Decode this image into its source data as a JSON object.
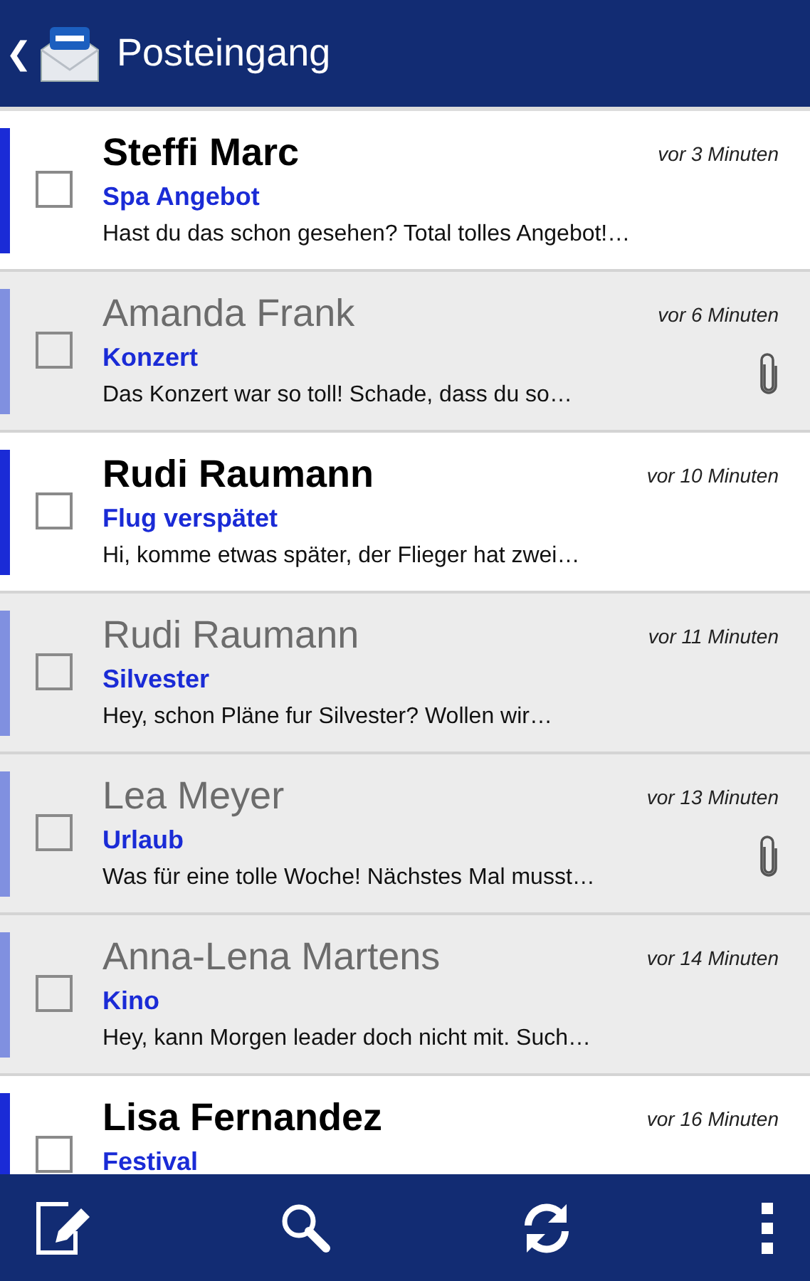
{
  "app_bar": {
    "back": "❮",
    "title": "Posteingang"
  },
  "messages": [
    {
      "sender": "Steffi Marc",
      "subject": "Spa Angebot",
      "preview": "Hast du das schon gesehen? Total tolles Angebot!…",
      "time": "vor 3 Minuten",
      "unread": true,
      "attachment": false,
      "checked": false
    },
    {
      "sender": "Amanda Frank",
      "subject": "Konzert",
      "preview": "Das Konzert war so toll! Schade, dass du so…",
      "time": "vor 6 Minuten",
      "unread": false,
      "attachment": true,
      "checked": false
    },
    {
      "sender": "Rudi Raumann",
      "subject": "Flug verspätet",
      "preview": "Hi, komme etwas später, der Flieger hat zwei…",
      "time": "vor 10 Minuten",
      "unread": true,
      "attachment": false,
      "checked": false
    },
    {
      "sender": "Rudi Raumann",
      "subject": "Silvester",
      "preview": "Hey, schon Pläne fur Silvester? Wollen wir…",
      "time": "vor 11 Minuten",
      "unread": false,
      "attachment": false,
      "checked": false
    },
    {
      "sender": "Lea Meyer",
      "subject": "Urlaub",
      "preview": "Was für eine tolle Woche! Nächstes Mal musst…",
      "time": "vor 13 Minuten",
      "unread": false,
      "attachment": true,
      "checked": false
    },
    {
      "sender": "Anna-Lena Martens",
      "subject": "Kino",
      "preview": "Hey, kann Morgen leader doch nicht mit. Such…",
      "time": "vor 14 Minuten",
      "unread": false,
      "attachment": false,
      "checked": false
    },
    {
      "sender": "Lisa Fernandez",
      "subject": "Festival",
      "time": "vor 16 Minuten",
      "unread": true,
      "checked": false
    }
  ]
}
